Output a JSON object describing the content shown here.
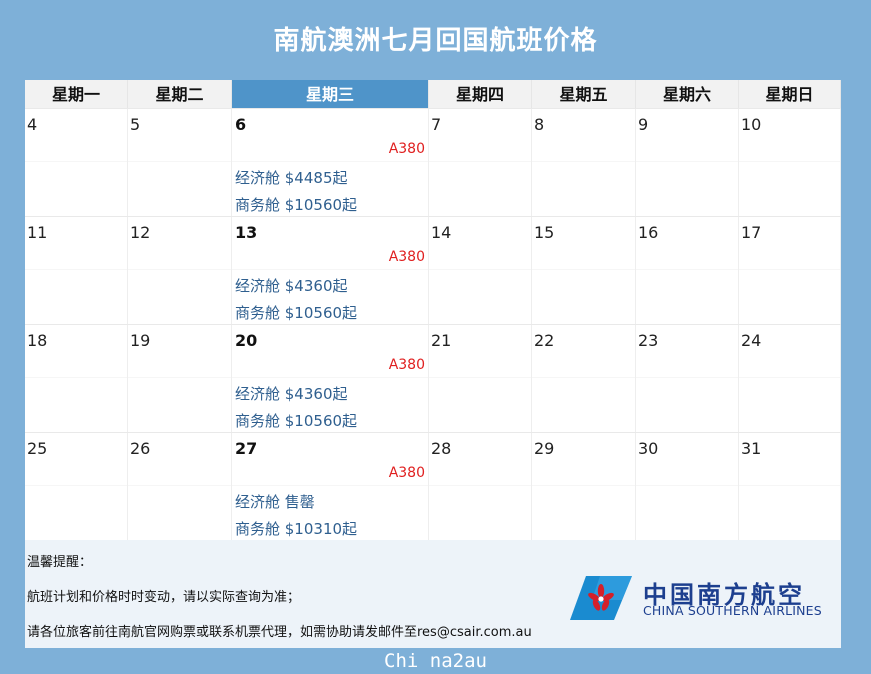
{
  "title": "南航澳洲七月回国航班价格",
  "weekdays": [
    "星期一",
    "星期二",
    "星期三",
    "星期四",
    "星期五",
    "星期六",
    "星期日"
  ],
  "active_weekday_index": 2,
  "weeks": [
    {
      "days": [
        "4",
        "5",
        "6",
        "7",
        "8",
        "9",
        "10"
      ],
      "flight": {
        "aircraft": "A380",
        "economy": "经济舱 $4485起",
        "business": "商务舱 $10560起"
      }
    },
    {
      "days": [
        "11",
        "12",
        "13",
        "14",
        "15",
        "16",
        "17"
      ],
      "flight": {
        "aircraft": "A380",
        "economy": "经济舱 $4360起",
        "business": "商务舱 $10560起"
      }
    },
    {
      "days": [
        "18",
        "19",
        "20",
        "21",
        "22",
        "23",
        "24"
      ],
      "flight": {
        "aircraft": "A380",
        "economy": "经济舱 $4360起",
        "business": "商务舱 $10560起"
      }
    },
    {
      "days": [
        "25",
        "26",
        "27",
        "28",
        "29",
        "30",
        "31"
      ],
      "flight": {
        "aircraft": "A380",
        "economy": "经济舱 售罄",
        "business": "商务舱 $10310起"
      }
    }
  ],
  "notes": {
    "heading": "温馨提醒：",
    "line1": "航班计划和价格时时变动，请以实际查询为准；",
    "line2": "请各位旅客前往南航官网购票或联系机票代理，如需协助请发邮件至res@csair.com.au"
  },
  "logo": {
    "name_cn": "中国南方航空",
    "name_en": "CHINA SOUTHERN AIRLINES",
    "icon": "kapok-flower-tail-icon"
  },
  "watermark": "Chi na2au",
  "colors": {
    "background": "#7eb0d8",
    "active_header": "#4f94c9",
    "aircraft": "#e02020",
    "fare": "#2f5f8f",
    "brand_blue": "#1d3f8f",
    "brand_red": "#d4202a",
    "brand_sky": "#1a8bd0"
  }
}
